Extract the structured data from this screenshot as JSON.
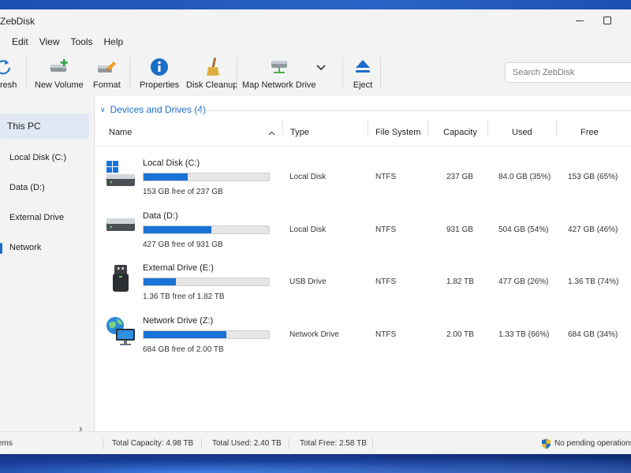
{
  "app": {
    "title": "ZebDisk"
  },
  "menu": [
    "Edit",
    "View",
    "Tools",
    "Help"
  ],
  "toolbar": {
    "refresh": "resh",
    "new_volume": "New Volume",
    "format": "Format",
    "properties": "Properties",
    "disk_cleanup": "Disk Cleanup",
    "map_network_drive": "Map Network Drive",
    "eject": "Eject",
    "search_placeholder": "Search ZebDisk"
  },
  "sidebar": {
    "items": [
      "This PC",
      "Local Disk (C:)",
      "Data (D:)",
      "External Drive",
      "Network"
    ],
    "active": "This PC"
  },
  "group": {
    "label": "Devices and Drives (4)"
  },
  "columns": [
    "Name",
    "Type",
    "File System",
    "Capacity",
    "Used",
    "Free"
  ],
  "drives": [
    {
      "name": "Local Disk (C:)",
      "icon": "windows-drive-icon",
      "used_fraction": 0.35,
      "free_text": "153 GB free of 237 GB",
      "type": "Local Disk",
      "fs": "NTFS",
      "capacity": "237 GB",
      "used": "84.0 GB (35%)",
      "free": "153 GB (65%)"
    },
    {
      "name": "Data (D:)",
      "icon": "hard-drive-icon",
      "used_fraction": 0.54,
      "free_text": "427 GB free of 931 GB",
      "type": "Local Disk",
      "fs": "NTFS",
      "capacity": "931 GB",
      "used": "504 GB (54%)",
      "free": "427 GB (46%)"
    },
    {
      "name": "External Drive (E:)",
      "icon": "usb-drive-icon",
      "used_fraction": 0.26,
      "free_text": "1.36 TB free of 1.82 TB",
      "type": "USB Drive",
      "fs": "NTFS",
      "capacity": "1.82 TB",
      "used": "477 GB (26%)",
      "free": "1.36 TB (74%)"
    },
    {
      "name": "Network Drive (Z:)",
      "icon": "network-drive-icon",
      "used_fraction": 0.66,
      "free_text": "684 GB free of 2.00 TB",
      "type": "Network Drive",
      "fs": "NTFS",
      "capacity": "2.00 TB",
      "used": "1.33 TB (66%)",
      "free": "684 GB (34%)"
    }
  ],
  "status": {
    "items": "ems",
    "total_capacity": "Total Capacity: 4.98 TB",
    "total_used": "Total Used: 2.40 TB",
    "total_free": "Total Free: 2.58 TB",
    "operations": "No pending operations"
  },
  "colors": {
    "accent": "#1a73d6",
    "link": "#1a6ec8"
  }
}
